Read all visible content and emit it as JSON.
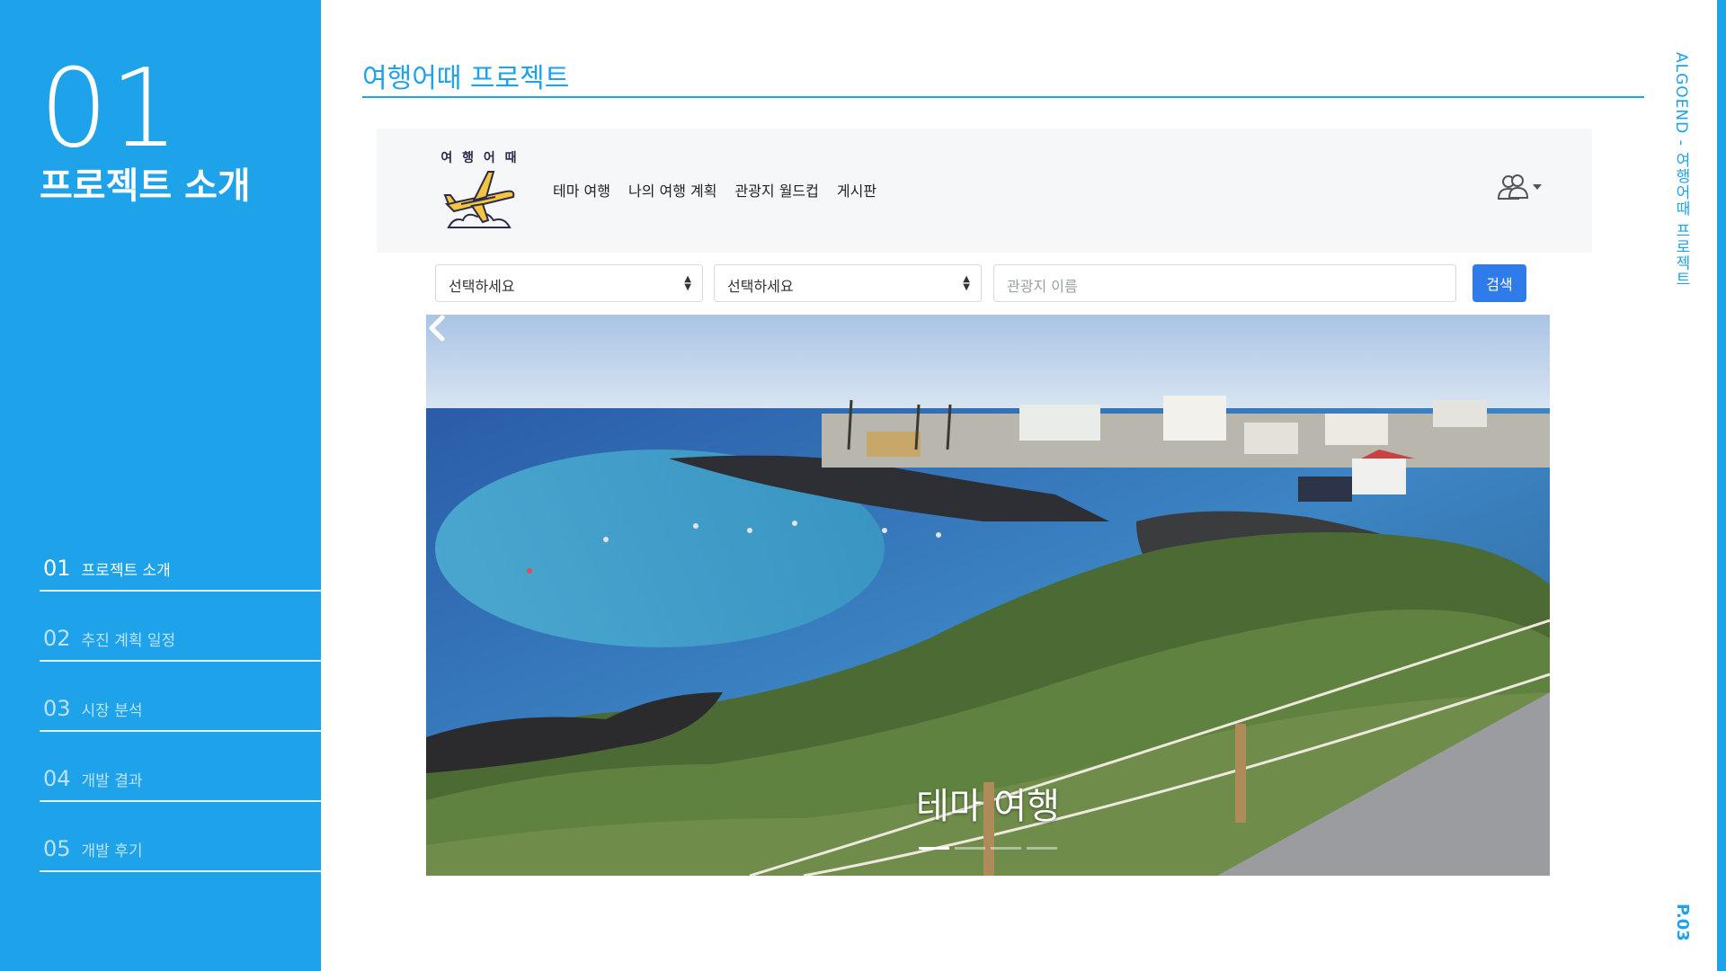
{
  "sidebar": {
    "section_number": "01",
    "section_title": "프로젝트 소개",
    "toc": [
      {
        "num": "01",
        "label": "프로젝트 소개",
        "active": true
      },
      {
        "num": "02",
        "label": "추진 계획 일정",
        "active": false
      },
      {
        "num": "03",
        "label": "시장 분석",
        "active": false
      },
      {
        "num": "04",
        "label": "개발 결과",
        "active": false
      },
      {
        "num": "05",
        "label": "개발 후기",
        "active": false
      }
    ]
  },
  "header": {
    "title": "여행어때 프로젝트"
  },
  "side_label": "ALGOEND - 여행어때 프로젝트",
  "page_number": "P.03",
  "website": {
    "logo_text": "여 행 어 때",
    "nav": [
      "테마 여행",
      "나의 여행 계획",
      "관광지 월드컵",
      "게시판"
    ],
    "user_icon": "users-icon",
    "search": {
      "select1": "선택하세요",
      "select2": "선택하세요",
      "input_placeholder": "관광지 이름",
      "button": "검색"
    },
    "carousel": {
      "caption": "테마 여행",
      "slides": 4,
      "active_slide": 1
    }
  },
  "colors": {
    "accent": "#1ea2ea",
    "button": "#2f7bea"
  }
}
